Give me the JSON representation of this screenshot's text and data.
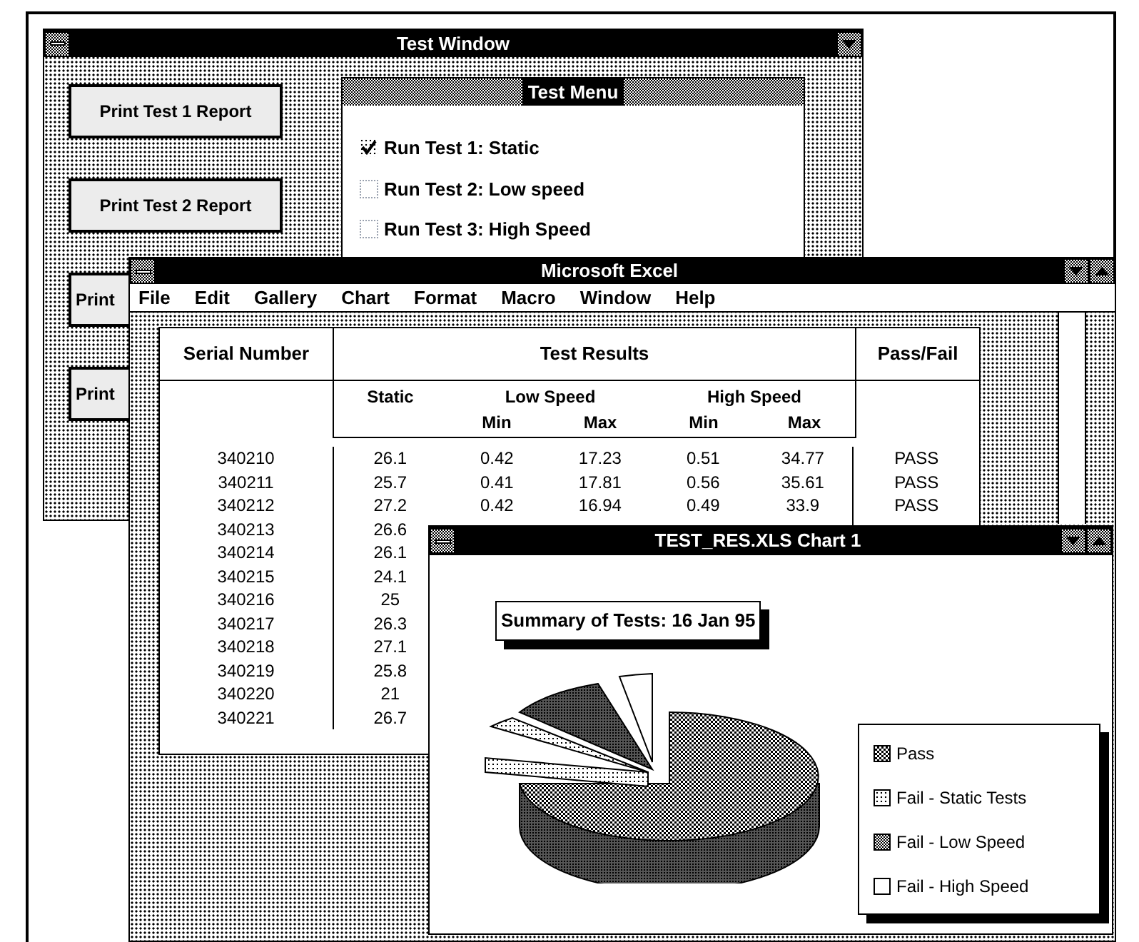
{
  "test_window": {
    "title": "Test Window",
    "buttons": [
      "Print Test 1 Report",
      "Print Test 2 Report",
      "Print",
      "Print"
    ],
    "test_menu": {
      "title": "Test Menu",
      "items": [
        {
          "label": "Run Test 1: Static",
          "checked": true
        },
        {
          "label": "Run Test 2: Low speed",
          "checked": false
        },
        {
          "label": "Run Test 3: High Speed",
          "checked": false
        }
      ]
    }
  },
  "excel": {
    "title": "Microsoft Excel",
    "menu": [
      "File",
      "Edit",
      "Gallery",
      "Chart",
      "Format",
      "Macro",
      "Window",
      "Help"
    ],
    "table": {
      "header": [
        "Serial Number",
        "Test Results",
        "Pass/Fail"
      ],
      "groups": [
        "Static",
        "Low Speed",
        "High Speed"
      ],
      "subheaders": [
        "Min",
        "Max",
        "Min",
        "Max"
      ],
      "rows": [
        {
          "cells": [
            "340210",
            "26.1",
            "0.42",
            "17.23",
            "0.51",
            "34.77",
            "PASS"
          ]
        },
        {
          "cells": [
            "340211",
            "25.7",
            "0.41",
            "17.81",
            "0.56",
            "35.61",
            "PASS"
          ]
        },
        {
          "cells": [
            "340212",
            "27.2",
            "0.42",
            "16.94",
            "0.49",
            "33.9",
            "PASS"
          ]
        },
        {
          "cells": [
            "340213",
            "26.6"
          ]
        },
        {
          "cells": [
            "340214",
            "26.1"
          ]
        },
        {
          "cells": [
            "340215",
            "24.1"
          ]
        },
        {
          "cells": [
            "340216",
            "25"
          ]
        },
        {
          "cells": [
            "340217",
            "26.3"
          ]
        },
        {
          "cells": [
            "340218",
            "27.1"
          ]
        },
        {
          "cells": [
            "340219",
            "25.8"
          ]
        },
        {
          "cells": [
            "340220",
            "21"
          ]
        },
        {
          "cells": [
            "340221",
            "26.7"
          ]
        }
      ]
    }
  },
  "chart_window": {
    "title": "TEST_RES.XLS Chart 1",
    "chart_title": "Summary of Tests: 16 Jan 95",
    "legend": [
      {
        "label": "Pass",
        "kind": "dense"
      },
      {
        "label": "Fail - Static Tests",
        "kind": "light"
      },
      {
        "label": "Fail - Low Speed",
        "kind": "dark"
      },
      {
        "label": "Fail - High Speed",
        "kind": "blank"
      }
    ]
  }
}
